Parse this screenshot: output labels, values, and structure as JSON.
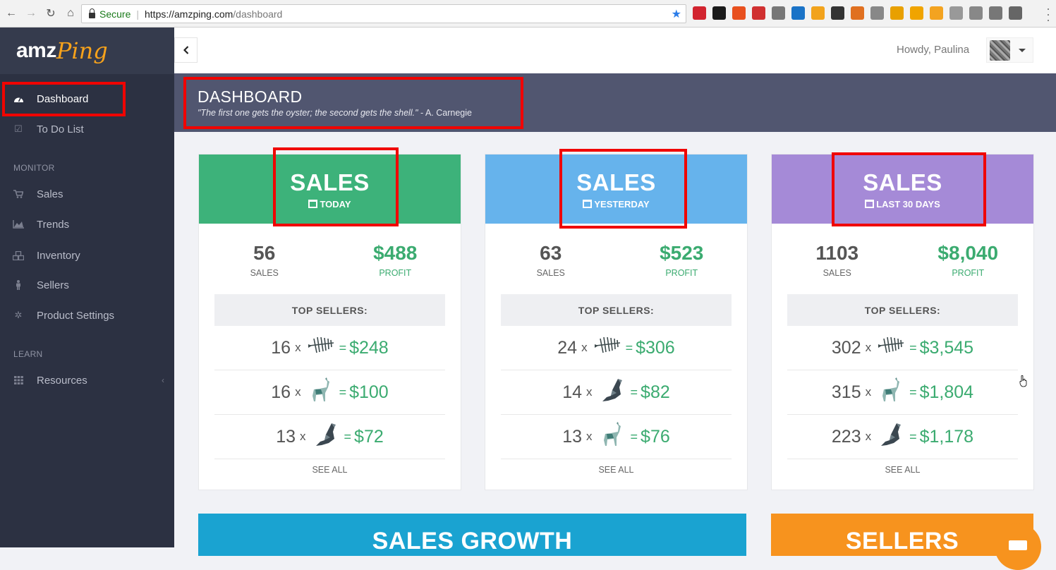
{
  "browser": {
    "secure_label": "Secure",
    "url_host": "https://amzping.com",
    "url_path": "/dashboard",
    "extension_colors": [
      "#d2242f",
      "#1b1b1b",
      "#e8501e",
      "#d03030",
      "#777777",
      "#1a73c7",
      "#f2a31c",
      "#333333",
      "#e07020",
      "#888888",
      "#e8a000",
      "#f0a400",
      "#f3a320",
      "#999999",
      "#888888",
      "#777777",
      "#666666"
    ]
  },
  "logo": {
    "part1": "amz",
    "part2": "Ping"
  },
  "sidebar": {
    "items": [
      {
        "label": "Dashboard",
        "icon": "dashboard-gauge-icon"
      },
      {
        "label": "To Do List",
        "icon": "checklist-icon"
      }
    ],
    "monitor_label": "MONITOR",
    "monitor_items": [
      {
        "label": "Sales",
        "icon": "cart-icon"
      },
      {
        "label": "Trends",
        "icon": "area-chart-icon"
      },
      {
        "label": "Inventory",
        "icon": "cubes-icon"
      },
      {
        "label": "Sellers",
        "icon": "person-icon"
      },
      {
        "label": "Product Settings",
        "icon": "gear-icon"
      }
    ],
    "learn_label": "LEARN",
    "learn_items": [
      {
        "label": "Resources",
        "icon": "grid-icon"
      }
    ]
  },
  "topbar": {
    "howdy": "Howdy, Paulina"
  },
  "header": {
    "title": "DASHBOARD",
    "quote": "\"The first one gets the oyster; the second gets the shell.\"",
    "author": " - A. Carnegie"
  },
  "cards": [
    {
      "title": "SALES",
      "period": "TODAY",
      "color": "#3db27a",
      "sales": "56",
      "sales_label": "SALES",
      "profit": "$488",
      "profit_label": "PROFIT",
      "top_label": "TOP SELLERS:",
      "rows": [
        {
          "qty": "16",
          "x": "x",
          "product": "fishbone",
          "eq": "=",
          "value": "$248"
        },
        {
          "qty": "16",
          "x": "x",
          "product": "llama",
          "eq": "=",
          "value": "$100"
        },
        {
          "qty": "13",
          "x": "x",
          "product": "wolf",
          "eq": "=",
          "value": "$72"
        }
      ],
      "see_all": "SEE ALL"
    },
    {
      "title": "SALES",
      "period": "YESTERDAY",
      "color": "#66b3ec",
      "sales": "63",
      "sales_label": "SALES",
      "profit": "$523",
      "profit_label": "PROFIT",
      "top_label": "TOP SELLERS:",
      "rows": [
        {
          "qty": "24",
          "x": "x",
          "product": "fishbone",
          "eq": "=",
          "value": "$306"
        },
        {
          "qty": "14",
          "x": "x",
          "product": "wolf",
          "eq": "=",
          "value": "$82"
        },
        {
          "qty": "13",
          "x": "x",
          "product": "llama",
          "eq": "=",
          "value": "$76"
        }
      ],
      "see_all": "SEE ALL"
    },
    {
      "title": "SALES",
      "period": "LAST 30 DAYS",
      "color": "#a58ad7",
      "sales": "1103",
      "sales_label": "SALES",
      "profit": "$8,040",
      "profit_label": "PROFIT",
      "top_label": "TOP SELLERS:",
      "rows": [
        {
          "qty": "302",
          "x": "x",
          "product": "fishbone",
          "eq": "=",
          "value": "$3,545"
        },
        {
          "qty": "315",
          "x": "x",
          "product": "llama",
          "eq": "=",
          "value": "$1,804"
        },
        {
          "qty": "223",
          "x": "x",
          "product": "wolf",
          "eq": "=",
          "value": "$1,178"
        }
      ],
      "see_all": "SEE ALL"
    }
  ],
  "banners": [
    {
      "label": "SALES GROWTH",
      "color": "#1aa3d1"
    },
    {
      "label": "SELLERS",
      "color": "#f7931e"
    }
  ]
}
